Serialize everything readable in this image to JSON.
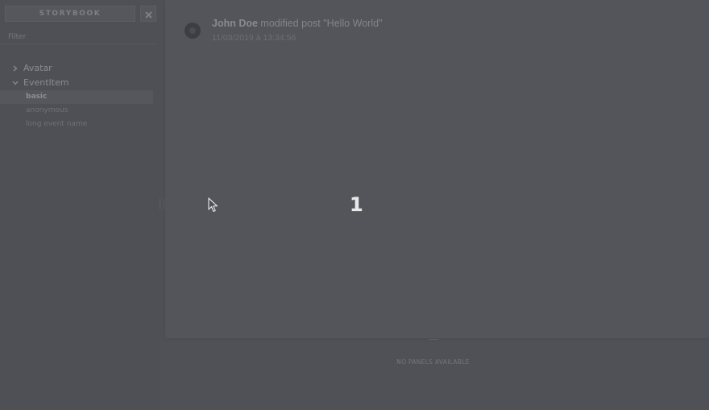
{
  "sidebar": {
    "brand": "STORYBOOK",
    "filter_placeholder": "Filter",
    "kinds": [
      {
        "label": "Avatar",
        "expanded": false,
        "stories": []
      },
      {
        "label": "EventItem",
        "expanded": true,
        "stories": [
          {
            "label": "basic",
            "selected": true
          },
          {
            "label": "anonymous",
            "selected": false
          },
          {
            "label": "long event name",
            "selected": false
          }
        ]
      }
    ]
  },
  "preview": {
    "event": {
      "author": "John Doe",
      "action": " modified post \"Hello World\"",
      "date": "11/03/2019 à 13:34:56"
    },
    "overlay_number": "1"
  },
  "addons": {
    "empty_text": "NO PANELS AVAILABLE"
  },
  "colors": {
    "background": "#4f5157",
    "preview": "#53555b",
    "overlay_number": "#e8e8e8"
  }
}
